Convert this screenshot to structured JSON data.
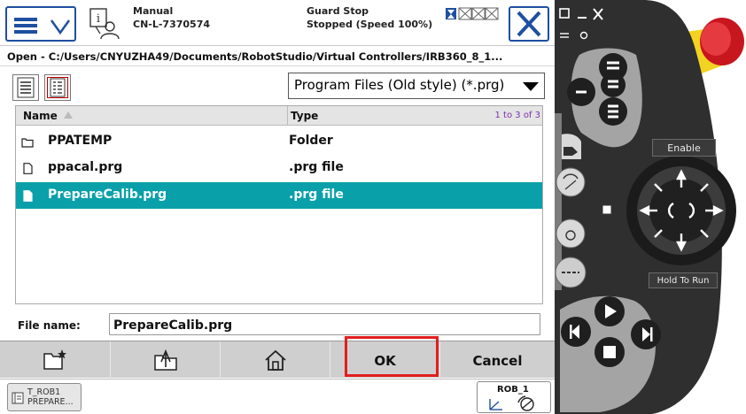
{
  "header": {
    "mode": "Manual",
    "controller": "CN-L-7370574",
    "state_title": "Guard Stop",
    "state_detail": "Stopped (Speed 100%)"
  },
  "dialog": {
    "path": "Open - C:/Users/CNYUZHA49/Documents/RobotStudio/Virtual Controllers/IRB360_8_1...",
    "filter": "Program Files (Old style) (*.prg)",
    "columns": {
      "name": "Name",
      "type": "Type"
    },
    "count": "1 to 3 of 3",
    "files": [
      {
        "name": "PPATEMP",
        "type": "Folder",
        "icon": "folder-icon"
      },
      {
        "name": "ppacal.prg",
        "type": ".prg file",
        "icon": "file-icon"
      },
      {
        "name": "PrepareCalib.prg",
        "type": ".prg file",
        "icon": "file-icon",
        "selected": true
      }
    ],
    "filename_label": "File name:",
    "filename_value": "PrepareCalib.prg"
  },
  "commands": {
    "ok": "OK",
    "cancel": "Cancel"
  },
  "taskbar": {
    "task_line1": "T_ROB1",
    "task_line2": "PREPARE...",
    "robot": "ROB_1"
  },
  "pendant": {
    "enable": "Enable",
    "hold_to_run": "Hold To Run"
  },
  "colors": {
    "accent": "#1e4fa0",
    "selection": "#0aa0aa",
    "highlight": "#e31e1e",
    "pendant_body": "#3b3b3b",
    "emergency_stop": "#d4202a"
  }
}
